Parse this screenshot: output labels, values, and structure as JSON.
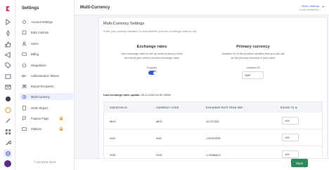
{
  "sidebar": {
    "title": "Settings",
    "items": [
      {
        "label": "Account Settings",
        "icon": "gear-icon"
      },
      {
        "label": "Data Controls",
        "icon": "data-icon"
      },
      {
        "label": "Users",
        "icon": "user-icon"
      },
      {
        "label": "Billing",
        "icon": "billing-icon"
      },
      {
        "label": "Integrations",
        "icon": "plug-icon"
      },
      {
        "label": "Authentication Tokens",
        "icon": "key-icon"
      },
      {
        "label": "Report Recipients",
        "icon": "people-icon"
      },
      {
        "label": "Multi-Currency",
        "icon": "currency-icon"
      },
      {
        "label": "Order Report",
        "icon": "report-icon"
      },
      {
        "label": "Feature Flags",
        "icon": "flag-icon"
      },
      {
        "label": "Platform",
        "icon": "platform-icon"
      }
    ],
    "footer": "© MOWNIN WAIN"
  },
  "header": {
    "title": "Multi-Currency",
    "store_name": "Noelo Internal",
    "store_subtitle": "xmaefe-9070625070"
  },
  "card": {
    "title": "Multi-Currency Settings",
    "description": "Enter your primary variation ID and whether you use exchange rates or not.",
    "exchange": {
      "heading": "Exchange rates",
      "text_line1": "Use exchange rates to set up multi currency prices",
      "text_line2": "and send your store's current exchange rates",
      "toggle_label": "Enabled",
      "enabled": true
    },
    "primary": {
      "heading": "Primary currency",
      "text_line1": "Variation ID of the product variation that you will use",
      "text_line2": "as the primary currency in your store",
      "field_label": "Variation ID",
      "field_value": "GBP"
    },
    "last_rates_label": "Last exchange rates update:",
    "last_rates_value": "25.11.2019 12:05 +0000"
  },
  "table": {
    "headers": [
      "VARIATION ID",
      "CURRENCY CODE",
      "EXCHANGE RATE FROM GBP",
      "ROUND TO ⊘"
    ],
    "rows": [
      {
        "variation_id": "MKD",
        "currency_code": "MKD",
        "rate": "10.227343",
        "round_to": "100"
      },
      {
        "variation_id": "AUD",
        "currency_code": "AUD",
        "rate": "1.92412035",
        "round_to": "100"
      },
      {
        "variation_id": "SGD",
        "currency_code": "SGD",
        "rate": "1.78356613",
        "round_to": "100"
      }
    ]
  },
  "actions": {
    "save_label": "Save"
  },
  "colors": {
    "accent": "#3a56d4",
    "save": "#2e8a57",
    "brand": "#e0286e"
  }
}
